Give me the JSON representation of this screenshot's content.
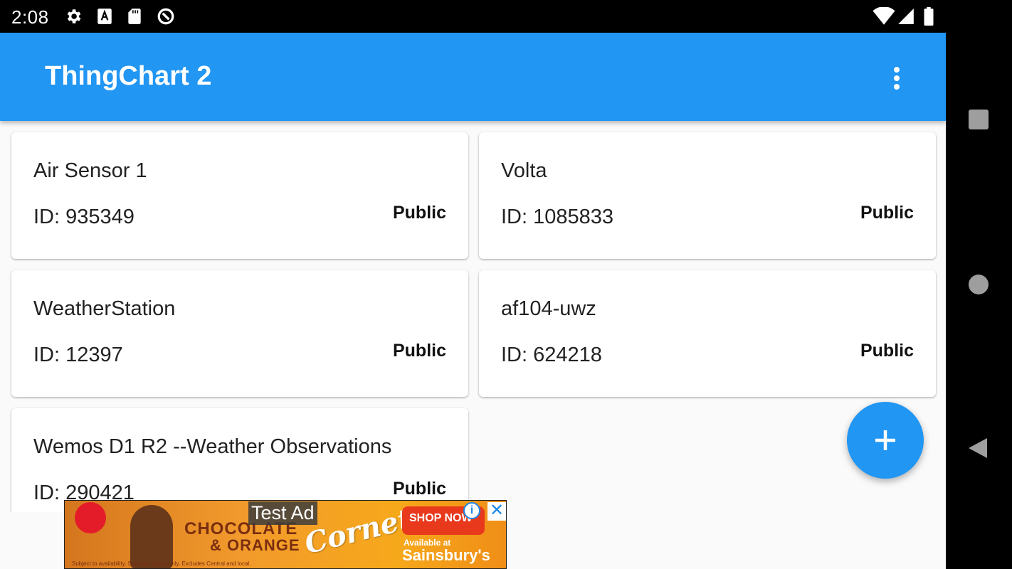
{
  "status_bar": {
    "time": "2:08",
    "left_icons": [
      "settings-icon",
      "font-a-icon",
      "sd-card-icon",
      "at-sign-icon"
    ],
    "right_icons": [
      "wifi-icon",
      "signal-icon",
      "battery-icon"
    ]
  },
  "app_bar": {
    "title": "ThingChart 2",
    "menu_icon": "more-vertical-icon"
  },
  "channels": [
    {
      "name": "Air Sensor 1",
      "id_text": "ID: 935349",
      "visibility": "Public"
    },
    {
      "name": "Volta",
      "id_text": "ID: 1085833",
      "visibility": "Public"
    },
    {
      "name": "WeatherStation",
      "id_text": "ID: 12397",
      "visibility": "Public"
    },
    {
      "name": "af104-uwz",
      "id_text": "ID: 624218",
      "visibility": "Public"
    },
    {
      "name": "Wemos D1 R2 --Weather Observations",
      "id_text": "ID: 290421",
      "visibility": "Public"
    }
  ],
  "fab": {
    "icon": "plus-icon",
    "label": "+"
  },
  "ad": {
    "label": "Test Ad",
    "headline_1": "CHOCOLATE",
    "headline_2": "& ORANGE",
    "brand": "Cornetto",
    "cta": "SHOP NOW",
    "available": "Available at",
    "store": "Sainsbury's",
    "fine_print": "Subject to availability. Selected stores only. Excludes Central and local.",
    "info_icon": "info-icon",
    "close_icon": "close-icon",
    "info_glyph": "i",
    "close_glyph": "✕"
  },
  "nav_bar": {
    "buttons": [
      "recents-square-icon",
      "home-circle-icon",
      "back-triangle-icon"
    ]
  },
  "colors": {
    "primary": "#2196f3",
    "background": "#fafafa",
    "card": "#ffffff",
    "status_bar": "#000000"
  }
}
